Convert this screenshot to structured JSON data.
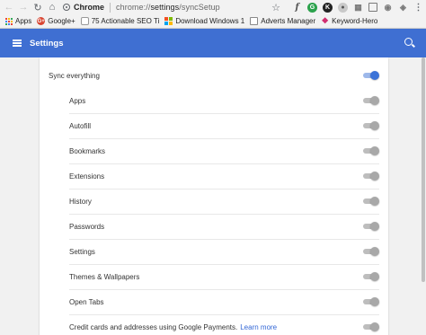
{
  "toolbar": {
    "origin": "Chrome",
    "url_scheme": "chrome://",
    "url_path_bold": "settings",
    "url_rest": "/syncSetup",
    "extension_letters": [
      "f",
      "G",
      "K",
      ""
    ]
  },
  "bookmarks": [
    {
      "name": "apps",
      "label": "Apps",
      "icon": "apps-grid-icon"
    },
    {
      "name": "google-plus",
      "label": "Google+",
      "icon": "google-plus-icon",
      "glyph": "G+"
    },
    {
      "name": "seo-tips",
      "label": "75 Actionable SEO Ti",
      "icon": "page-icon"
    },
    {
      "name": "download-windows",
      "label": "Download Windows 1",
      "icon": "windows-icon"
    },
    {
      "name": "adverts-manager",
      "label": "Adverts Manager",
      "icon": "document-icon"
    },
    {
      "name": "keyword-hero",
      "label": "Keyword-Hero",
      "icon": "keyword-hero-icon"
    }
  ],
  "header": {
    "title": "Settings"
  },
  "sync": {
    "main_label": "Sync everything",
    "main_on": true,
    "items": [
      {
        "label": "Apps",
        "on": false
      },
      {
        "label": "Autofill",
        "on": false
      },
      {
        "label": "Bookmarks",
        "on": false
      },
      {
        "label": "Extensions",
        "on": false
      },
      {
        "label": "History",
        "on": false
      },
      {
        "label": "Passwords",
        "on": false
      },
      {
        "label": "Settings",
        "on": false
      },
      {
        "label": "Themes & Wallpapers",
        "on": false
      },
      {
        "label": "Open Tabs",
        "on": false
      },
      {
        "label": "Credit cards and addresses using Google Payments.",
        "link": "Learn more",
        "on": false
      }
    ]
  },
  "colors": {
    "header_blue": "#3f6fd2",
    "toggle_on": "#3b73d8",
    "link": "#3367d6"
  }
}
